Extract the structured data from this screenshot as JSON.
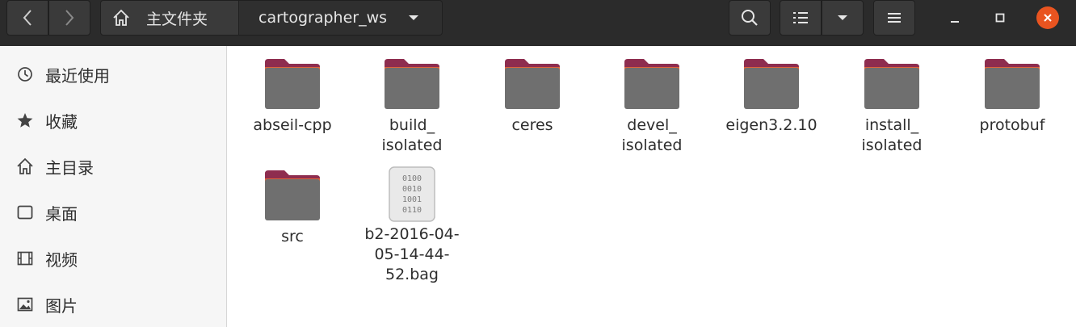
{
  "header": {
    "path": {
      "home_label": "主文件夹",
      "current_folder": "cartographer_ws"
    },
    "colors": {
      "bar_bg": "#2b2b2b",
      "close_accent": "#e95420"
    }
  },
  "sidebar": {
    "items": [
      {
        "label": "最近使用",
        "icon": "clock-icon"
      },
      {
        "label": "收藏",
        "icon": "star-icon"
      },
      {
        "label": "主目录",
        "icon": "home-icon"
      },
      {
        "label": "桌面",
        "icon": "desktop-icon"
      },
      {
        "label": "视频",
        "icon": "video-icon"
      },
      {
        "label": "图片",
        "icon": "image-icon"
      }
    ]
  },
  "files": [
    {
      "type": "folder",
      "line1": "abseil-cpp",
      "line2": ""
    },
    {
      "type": "folder",
      "line1": "build_",
      "line2": "isolated"
    },
    {
      "type": "folder",
      "line1": "ceres",
      "line2": ""
    },
    {
      "type": "folder",
      "line1": "devel_",
      "line2": "isolated"
    },
    {
      "type": "folder",
      "line1": "eigen3.2.10",
      "line2": ""
    },
    {
      "type": "folder",
      "line1": "install_",
      "line2": "isolated"
    },
    {
      "type": "folder",
      "line1": "protobuf",
      "line2": ""
    },
    {
      "type": "folder",
      "line1": "src",
      "line2": ""
    },
    {
      "type": "binary",
      "line1": "b2-2016-04-",
      "line2": "05-14-44-",
      "line3": "52.bag",
      "binary_text": [
        "0100",
        "0010",
        "1001",
        "0110"
      ]
    }
  ]
}
